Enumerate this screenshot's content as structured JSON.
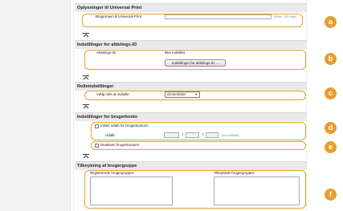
{
  "universal_print": {
    "section_title": "Oplysninger til Universal Print",
    "username_label": "Brugernavn til Universal Print:",
    "username_value": "",
    "max_hint": "(Maks. 250 tegn)",
    "badge": "a"
  },
  "department_id": {
    "section_title": "Indstillinger for afdelings-ID",
    "label": "Afdelings-ID:",
    "status": "Ikke indstillet.",
    "button_label": "Indstillinger for afdelings-ID ...",
    "badge": "b"
  },
  "role": {
    "section_title": "Rolleindstillinger",
    "label": "Vælg rolle at indstille:",
    "selected": "GeneralUser",
    "badge": "c"
  },
  "user_account": {
    "section_title": "Indstillinger for brugerkonto",
    "expiry_checkbox_label": "Indstil udløb for brugerkontoen",
    "expiry_checked": false,
    "expiry_label": "Udløb:",
    "date_separator": "/",
    "date_hint": "(mm/dd/ååå)",
    "year_value": "",
    "month_value": "",
    "day_value": "",
    "disable_checkbox_label": "Deaktiver brugerkontoen",
    "disable_checked": false,
    "badge_expiry": "d",
    "badge_disable": "e"
  },
  "user_groups": {
    "section_title": "Tilknytning af brugergruppe",
    "registered_label": "Registrerede brugergrupper:",
    "assigned_label": "Tilknyttede brugergrupper:",
    "badge": "f"
  },
  "colors": {
    "accent": "#e79d2f",
    "section_header_bg": "#e9e9e9"
  }
}
